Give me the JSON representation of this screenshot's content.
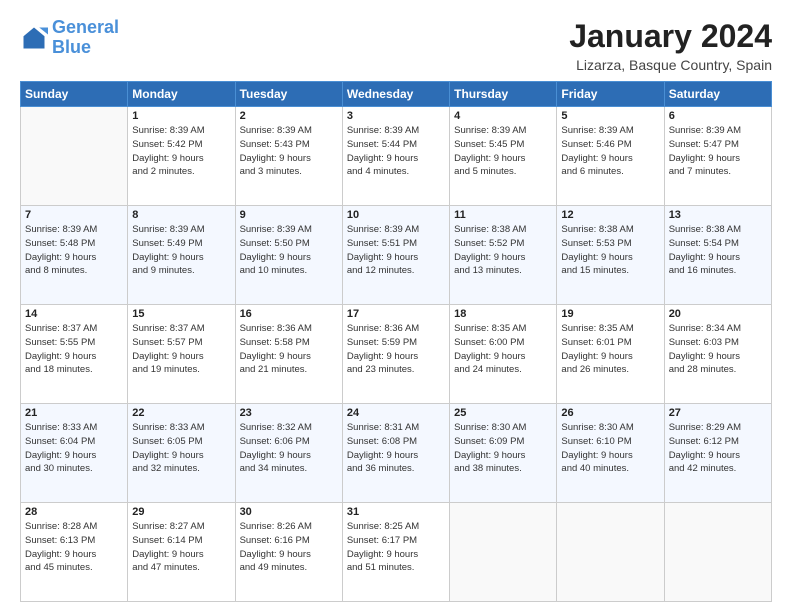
{
  "logo": {
    "line1": "General",
    "line2": "Blue"
  },
  "title": "January 2024",
  "subtitle": "Lizarza, Basque Country, Spain",
  "weekdays": [
    "Sunday",
    "Monday",
    "Tuesday",
    "Wednesday",
    "Thursday",
    "Friday",
    "Saturday"
  ],
  "weeks": [
    [
      {
        "day": "",
        "info": ""
      },
      {
        "day": "1",
        "info": "Sunrise: 8:39 AM\nSunset: 5:42 PM\nDaylight: 9 hours\nand 2 minutes."
      },
      {
        "day": "2",
        "info": "Sunrise: 8:39 AM\nSunset: 5:43 PM\nDaylight: 9 hours\nand 3 minutes."
      },
      {
        "day": "3",
        "info": "Sunrise: 8:39 AM\nSunset: 5:44 PM\nDaylight: 9 hours\nand 4 minutes."
      },
      {
        "day": "4",
        "info": "Sunrise: 8:39 AM\nSunset: 5:45 PM\nDaylight: 9 hours\nand 5 minutes."
      },
      {
        "day": "5",
        "info": "Sunrise: 8:39 AM\nSunset: 5:46 PM\nDaylight: 9 hours\nand 6 minutes."
      },
      {
        "day": "6",
        "info": "Sunrise: 8:39 AM\nSunset: 5:47 PM\nDaylight: 9 hours\nand 7 minutes."
      }
    ],
    [
      {
        "day": "7",
        "info": "Sunrise: 8:39 AM\nSunset: 5:48 PM\nDaylight: 9 hours\nand 8 minutes."
      },
      {
        "day": "8",
        "info": "Sunrise: 8:39 AM\nSunset: 5:49 PM\nDaylight: 9 hours\nand 9 minutes."
      },
      {
        "day": "9",
        "info": "Sunrise: 8:39 AM\nSunset: 5:50 PM\nDaylight: 9 hours\nand 10 minutes."
      },
      {
        "day": "10",
        "info": "Sunrise: 8:39 AM\nSunset: 5:51 PM\nDaylight: 9 hours\nand 12 minutes."
      },
      {
        "day": "11",
        "info": "Sunrise: 8:38 AM\nSunset: 5:52 PM\nDaylight: 9 hours\nand 13 minutes."
      },
      {
        "day": "12",
        "info": "Sunrise: 8:38 AM\nSunset: 5:53 PM\nDaylight: 9 hours\nand 15 minutes."
      },
      {
        "day": "13",
        "info": "Sunrise: 8:38 AM\nSunset: 5:54 PM\nDaylight: 9 hours\nand 16 minutes."
      }
    ],
    [
      {
        "day": "14",
        "info": "Sunrise: 8:37 AM\nSunset: 5:55 PM\nDaylight: 9 hours\nand 18 minutes."
      },
      {
        "day": "15",
        "info": "Sunrise: 8:37 AM\nSunset: 5:57 PM\nDaylight: 9 hours\nand 19 minutes."
      },
      {
        "day": "16",
        "info": "Sunrise: 8:36 AM\nSunset: 5:58 PM\nDaylight: 9 hours\nand 21 minutes."
      },
      {
        "day": "17",
        "info": "Sunrise: 8:36 AM\nSunset: 5:59 PM\nDaylight: 9 hours\nand 23 minutes."
      },
      {
        "day": "18",
        "info": "Sunrise: 8:35 AM\nSunset: 6:00 PM\nDaylight: 9 hours\nand 24 minutes."
      },
      {
        "day": "19",
        "info": "Sunrise: 8:35 AM\nSunset: 6:01 PM\nDaylight: 9 hours\nand 26 minutes."
      },
      {
        "day": "20",
        "info": "Sunrise: 8:34 AM\nSunset: 6:03 PM\nDaylight: 9 hours\nand 28 minutes."
      }
    ],
    [
      {
        "day": "21",
        "info": "Sunrise: 8:33 AM\nSunset: 6:04 PM\nDaylight: 9 hours\nand 30 minutes."
      },
      {
        "day": "22",
        "info": "Sunrise: 8:33 AM\nSunset: 6:05 PM\nDaylight: 9 hours\nand 32 minutes."
      },
      {
        "day": "23",
        "info": "Sunrise: 8:32 AM\nSunset: 6:06 PM\nDaylight: 9 hours\nand 34 minutes."
      },
      {
        "day": "24",
        "info": "Sunrise: 8:31 AM\nSunset: 6:08 PM\nDaylight: 9 hours\nand 36 minutes."
      },
      {
        "day": "25",
        "info": "Sunrise: 8:30 AM\nSunset: 6:09 PM\nDaylight: 9 hours\nand 38 minutes."
      },
      {
        "day": "26",
        "info": "Sunrise: 8:30 AM\nSunset: 6:10 PM\nDaylight: 9 hours\nand 40 minutes."
      },
      {
        "day": "27",
        "info": "Sunrise: 8:29 AM\nSunset: 6:12 PM\nDaylight: 9 hours\nand 42 minutes."
      }
    ],
    [
      {
        "day": "28",
        "info": "Sunrise: 8:28 AM\nSunset: 6:13 PM\nDaylight: 9 hours\nand 45 minutes."
      },
      {
        "day": "29",
        "info": "Sunrise: 8:27 AM\nSunset: 6:14 PM\nDaylight: 9 hours\nand 47 minutes."
      },
      {
        "day": "30",
        "info": "Sunrise: 8:26 AM\nSunset: 6:16 PM\nDaylight: 9 hours\nand 49 minutes."
      },
      {
        "day": "31",
        "info": "Sunrise: 8:25 AM\nSunset: 6:17 PM\nDaylight: 9 hours\nand 51 minutes."
      },
      {
        "day": "",
        "info": ""
      },
      {
        "day": "",
        "info": ""
      },
      {
        "day": "",
        "info": ""
      }
    ]
  ]
}
